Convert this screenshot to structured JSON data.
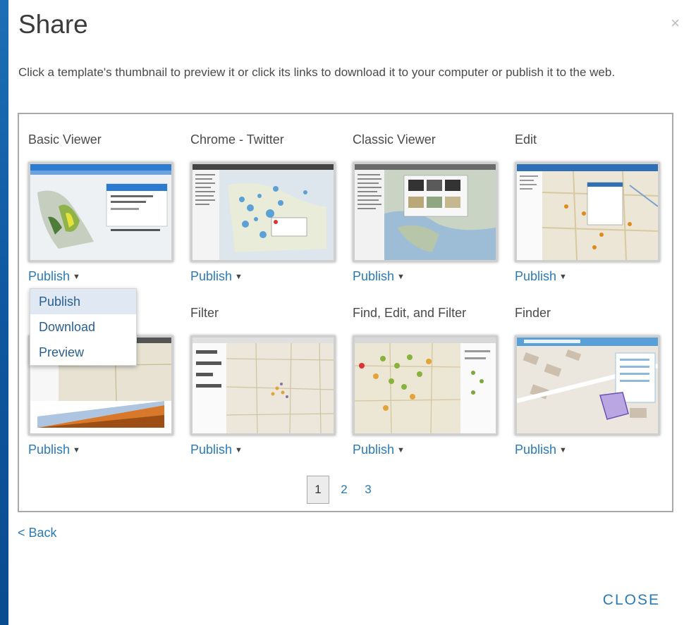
{
  "dialog": {
    "title": "Share",
    "close_icon": "×",
    "description": "Click a template's thumbnail to preview it or click its links to download it to your computer or publish it to the web.",
    "back_label": "< Back",
    "close_label": "CLOSE"
  },
  "templates": [
    {
      "name": "Basic Viewer",
      "publish": "Publish"
    },
    {
      "name": "Chrome - Twitter",
      "publish": "Publish"
    },
    {
      "name": "Classic Viewer",
      "publish": "Publish"
    },
    {
      "name": "Edit",
      "publish": "Publish"
    },
    {
      "name": "",
      "publish": "Publish"
    },
    {
      "name": "Filter",
      "publish": "Publish"
    },
    {
      "name": "Find, Edit, and Filter",
      "publish": "Publish"
    },
    {
      "name": "Finder",
      "publish": "Publish"
    }
  ],
  "dropdown": {
    "items": [
      "Publish",
      "Download",
      "Preview"
    ],
    "highlighted": "Publish"
  },
  "pagination": {
    "pages": [
      "1",
      "2",
      "3"
    ],
    "current": "1"
  },
  "colors": {
    "link": "#2a7ab8",
    "frame_blue": "#1665ad"
  }
}
